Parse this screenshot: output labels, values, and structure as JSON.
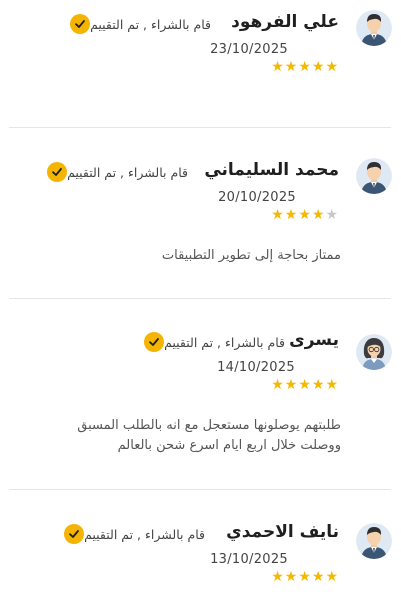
{
  "verified_label": "قام بالشراء , تم التقييم",
  "reviews": [
    {
      "name": "علي الفرهود",
      "date": "23/10/2025",
      "rating": 5,
      "avatar": "male-avatar-icon",
      "text": ""
    },
    {
      "name": "محمد السليماني",
      "date": "20/10/2025",
      "rating": 4,
      "avatar": "male-avatar-icon",
      "text": "ممتاز بحاجة إلى تطوير التطبيقات"
    },
    {
      "name": "يسرى",
      "date": "14/10/2025",
      "rating": 5,
      "avatar": "female-avatar-icon",
      "text_lines": [
        "طلبتهم يوصلونها مستعجل مع انه بالطلب المسبق",
        "ووصلت خلال اربع ايام اسرع شحن بالعالم"
      ]
    },
    {
      "name": "نايف الاحمدي",
      "date": "13/10/2025",
      "rating": 5,
      "avatar": "male-avatar-icon",
      "text": ""
    }
  ],
  "colors": {
    "star_on": "#f5b800",
    "star_off": "#c8c8c8",
    "check_badge": "#f4b400",
    "avatar_bg": "#dfe9f3",
    "avatar_suit": "#3b5575"
  }
}
